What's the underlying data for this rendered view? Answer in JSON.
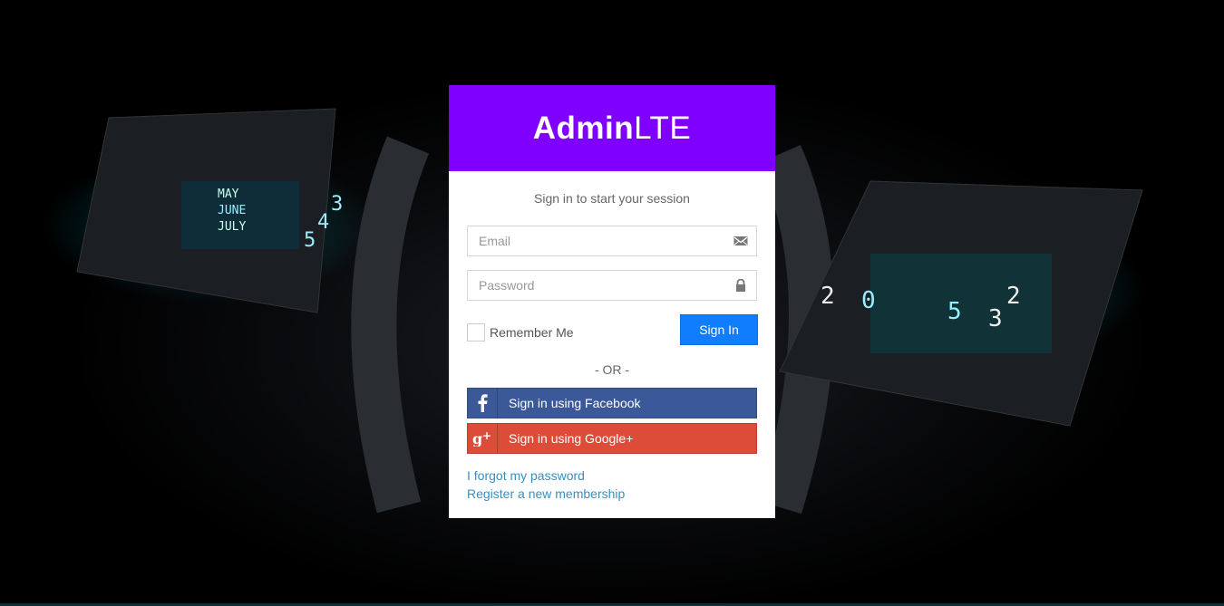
{
  "logo": {
    "bold": "Admin",
    "light": "LTE"
  },
  "login": {
    "message": "Sign in to start your session",
    "email_placeholder": "Email",
    "password_placeholder": "Password",
    "remember_label": "Remember Me",
    "signin_label": "Sign In",
    "or_label": "- OR -",
    "facebook_label": "Sign in using Facebook",
    "google_label": "Sign in using Google+",
    "forgot_label": "I forgot my password",
    "register_label": "Register a new membership"
  },
  "icons": {
    "email": "envelope-icon",
    "password": "lock-icon",
    "facebook": "facebook-icon",
    "google": "google-plus-icon"
  },
  "colors": {
    "header": "#7f00ff",
    "signin_button": "#0f7dfc",
    "facebook": "#3b5998",
    "google": "#dd4b39",
    "link": "#3c8dbc"
  }
}
